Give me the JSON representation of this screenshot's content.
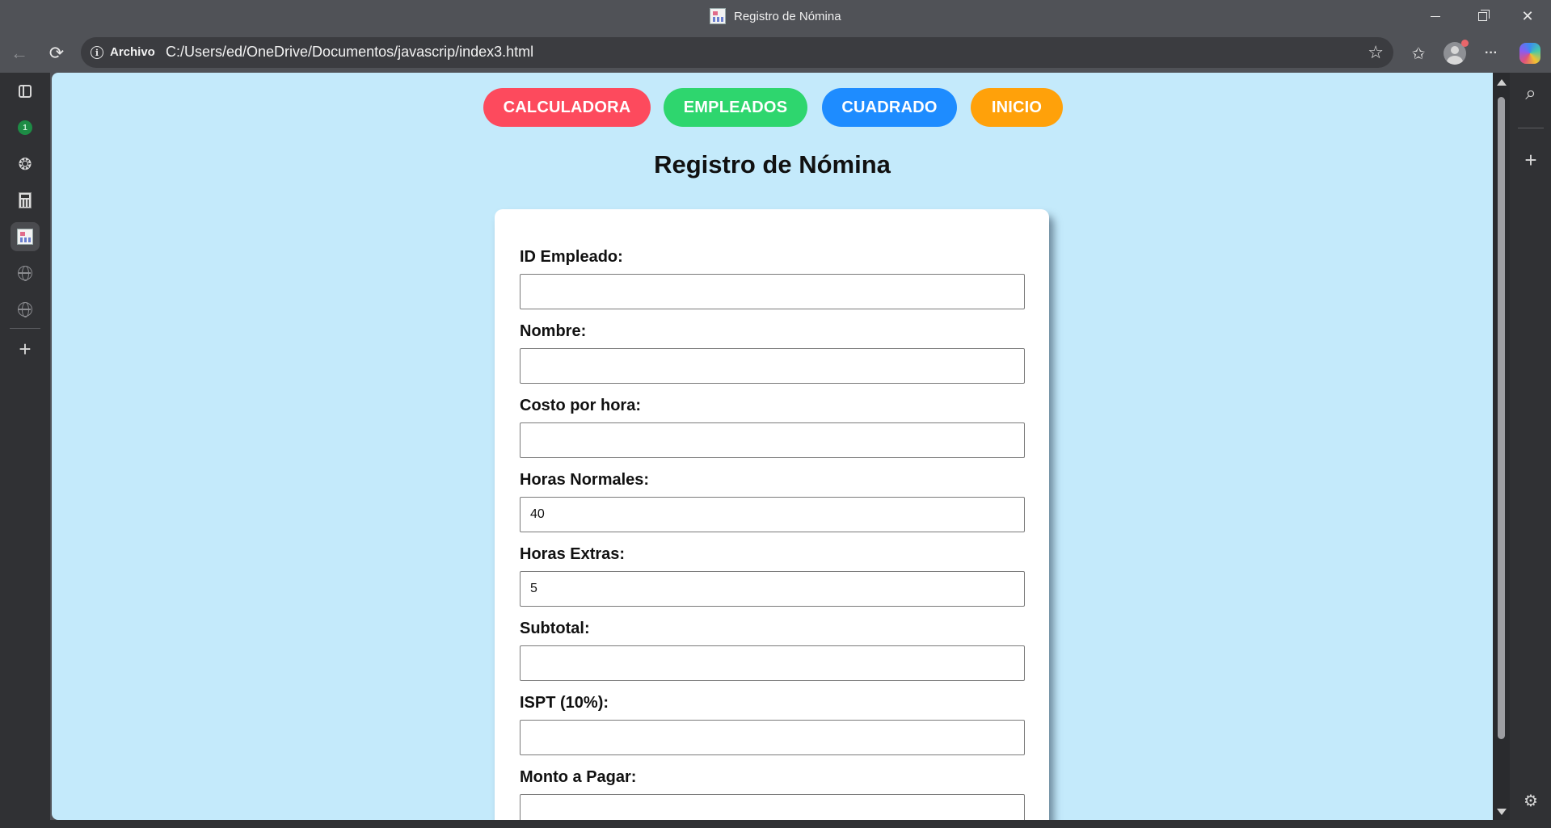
{
  "window": {
    "title": "Registro de Nómina",
    "controls": {
      "minimize": "—",
      "restore": "❐",
      "close": "✕"
    }
  },
  "toolbar": {
    "back_icon": "←",
    "refresh_icon": "⟳",
    "scheme_label": "Archivo",
    "info_icon": "i",
    "url": "C:/Users/ed/OneDrive/Documentos/javascrip/index3.html",
    "favorite_icon": "☆",
    "favorites_icon": "✩",
    "more_icon": "···"
  },
  "left_sidebar": {
    "items": [
      {
        "name": "tab-actions-icon"
      },
      {
        "name": "whatsapp-icon",
        "badge": "1"
      },
      {
        "name": "chatgpt-icon",
        "glyph": "❂"
      },
      {
        "name": "calculator-icon"
      },
      {
        "name": "payroll-page-icon"
      },
      {
        "name": "globe-icon"
      },
      {
        "name": "globe-icon"
      }
    ],
    "add_icon": "+"
  },
  "right_sidebar": {
    "search_icon": "⌕",
    "add_icon": "+",
    "settings_icon": "⚙"
  },
  "page": {
    "nav": [
      {
        "label": "CALCULADORA",
        "color": "#fd4a5d"
      },
      {
        "label": "EMPLEADOS",
        "color": "#2ed66e"
      },
      {
        "label": "CUADRADO",
        "color": "#1e8cff"
      },
      {
        "label": "INICIO",
        "color": "#ffa10a"
      }
    ],
    "title": "Registro de Nómina",
    "background": "#c4eafb",
    "fields": [
      {
        "label": "ID Empleado:",
        "value": ""
      },
      {
        "label": "Nombre:",
        "value": ""
      },
      {
        "label": "Costo por hora:",
        "value": ""
      },
      {
        "label": "Horas Normales:",
        "value": "40"
      },
      {
        "label": "Horas Extras:",
        "value": "5"
      },
      {
        "label": "Subtotal:",
        "value": ""
      },
      {
        "label": "ISPT (10%):",
        "value": ""
      },
      {
        "label": "Monto a Pagar:",
        "value": ""
      }
    ]
  }
}
